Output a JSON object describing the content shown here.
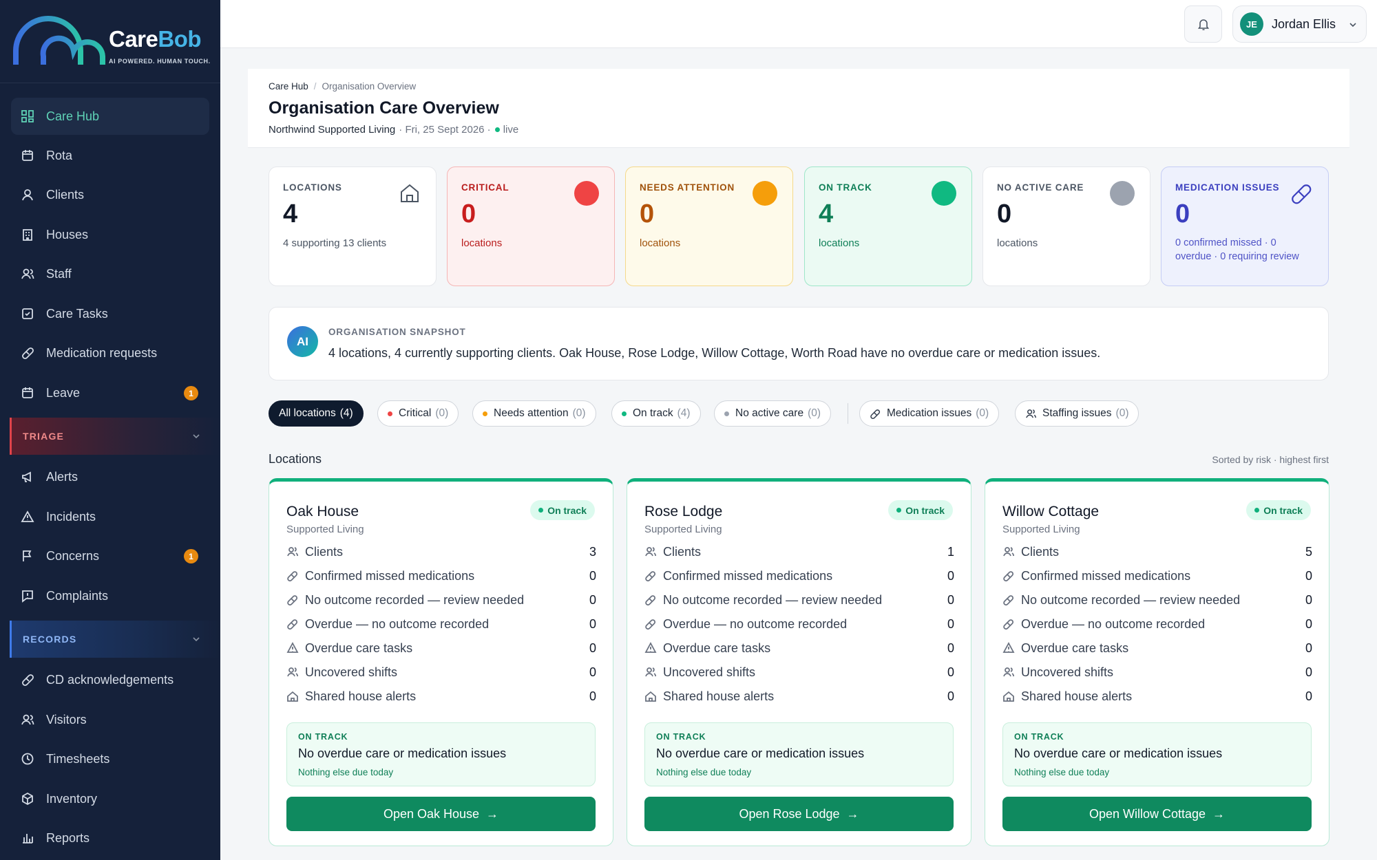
{
  "brand": {
    "name_a": "Care",
    "name_b": "Bob",
    "tagline": "AI POWERED. HUMAN TOUCH."
  },
  "sidebar": {
    "items": [
      {
        "label": "Care Hub",
        "icon": "grid-icon",
        "active": true
      },
      {
        "label": "Rota",
        "icon": "calendar-icon"
      },
      {
        "label": "Clients",
        "icon": "user-icon"
      },
      {
        "label": "Houses",
        "icon": "building-icon"
      },
      {
        "label": "Staff",
        "icon": "users-icon"
      },
      {
        "label": "Care Tasks",
        "icon": "checklist-icon"
      },
      {
        "label": "Medication requests",
        "icon": "pill-icon"
      },
      {
        "label": "Leave",
        "icon": "calendar-icon",
        "badge": "1"
      }
    ],
    "triage": {
      "label": "TRIAGE",
      "items": [
        {
          "label": "Alerts",
          "icon": "megaphone-icon"
        },
        {
          "label": "Incidents",
          "icon": "warning-icon"
        },
        {
          "label": "Concerns",
          "icon": "flag-icon",
          "badge": "1"
        },
        {
          "label": "Complaints",
          "icon": "message-alert-icon"
        }
      ]
    },
    "records": {
      "label": "RECORDS",
      "items": [
        {
          "label": "CD acknowledgements",
          "icon": "pill-icon"
        },
        {
          "label": "Visitors",
          "icon": "users-icon"
        },
        {
          "label": "Timesheets",
          "icon": "clock-icon"
        },
        {
          "label": "Inventory",
          "icon": "box-icon"
        },
        {
          "label": "Reports",
          "icon": "bar-chart-icon"
        }
      ]
    }
  },
  "topbar": {
    "user_initials": "JE",
    "user_name": "Jordan Ellis"
  },
  "header": {
    "breadcrumb_root": "Care Hub",
    "breadcrumb_current": "Organisation Overview",
    "title": "Organisation Care Overview",
    "org_name": "Northwind Supported Living",
    "date": "· Fri, 25 Sept 2026 ·",
    "live": "live"
  },
  "stats": [
    {
      "label": "LOCATIONS",
      "value": "4",
      "sub": "4 supporting 13 clients"
    },
    {
      "label": "CRITICAL",
      "value": "0",
      "sub": "locations",
      "color": "#ef4444"
    },
    {
      "label": "NEEDS ATTENTION",
      "value": "0",
      "sub": "locations",
      "color": "#f59e0b"
    },
    {
      "label": "ON TRACK",
      "value": "4",
      "sub": "locations",
      "color": "#10b981"
    },
    {
      "label": "NO ACTIVE CARE",
      "value": "0",
      "sub": "locations",
      "color": "#9ca3af"
    },
    {
      "label": "MEDICATION ISSUES",
      "value": "0",
      "sub": "0 confirmed missed · 0 overdue · 0 requiring review"
    }
  ],
  "snapshot": {
    "badge": "AI",
    "label": "ORGANISATION SNAPSHOT",
    "text": "4 locations, 4 currently supporting clients. Oak House, Rose Lodge, Willow Cottage, Worth Road have no overdue care or medication issues."
  },
  "filters": [
    {
      "label": "All locations",
      "count": "(4)"
    },
    {
      "label": "Critical",
      "count": "(0)",
      "color": "#ef4444"
    },
    {
      "label": "Needs attention",
      "count": "(0)",
      "color": "#f59e0b"
    },
    {
      "label": "On track",
      "count": "(4)",
      "color": "#10b981"
    },
    {
      "label": "No active care",
      "count": "(0)",
      "color": "#9ca3af"
    },
    {
      "label": "Medication issues",
      "count": "(0)"
    },
    {
      "label": "Staffing issues",
      "count": "(0)"
    }
  ],
  "locations_heading": "Locations",
  "sort_note": "Sorted by risk · highest first",
  "metric_labels": [
    "Clients",
    "Confirmed missed medications",
    "No outcome recorded — review needed",
    "Overdue — no outcome recorded",
    "Overdue care tasks",
    "Uncovered shifts",
    "Shared house alerts"
  ],
  "locations": [
    {
      "name": "Oak House",
      "type": "Supported Living",
      "status": "On track",
      "values": [
        "3",
        "0",
        "0",
        "0",
        "0",
        "0",
        "0"
      ],
      "box_label": "ON TRACK",
      "box_title": "No overdue care or medication issues",
      "box_sub": "Nothing else due today",
      "button": "Open Oak House"
    },
    {
      "name": "Rose Lodge",
      "type": "Supported Living",
      "status": "On track",
      "values": [
        "1",
        "0",
        "0",
        "0",
        "0",
        "0",
        "0"
      ],
      "box_label": "ON TRACK",
      "box_title": "No overdue care or medication issues",
      "box_sub": "Nothing else due today",
      "button": "Open Rose Lodge"
    },
    {
      "name": "Willow Cottage",
      "type": "Supported Living",
      "status": "On track",
      "values": [
        "5",
        "0",
        "0",
        "0",
        "0",
        "0",
        "0"
      ],
      "box_label": "ON TRACK",
      "box_title": "No overdue care or medication issues",
      "box_sub": "Nothing else due today",
      "button": "Open Willow Cottage"
    }
  ]
}
